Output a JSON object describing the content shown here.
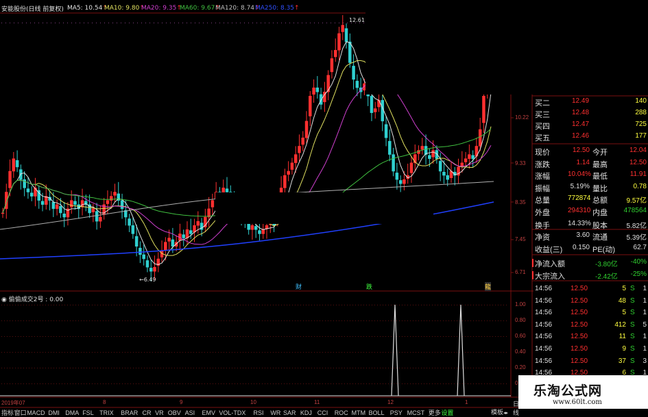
{
  "header": {
    "stock_name": "安能股份(日线 前复权)",
    "ma_items": [
      {
        "text": "MA5: 10.54",
        "color": "#e0e0e0"
      },
      {
        "text": "MA10: 9.80",
        "color": "#e0e060"
      },
      {
        "text": "MA20: 9.35",
        "color": "#d040d0"
      },
      {
        "text": "MA60: 9.67",
        "color": "#40c040"
      },
      {
        "text": "MA120: 8.74",
        "color": "#c0c0c0"
      },
      {
        "text": "MA250: 8.35",
        "color": "#3050ff"
      }
    ]
  },
  "price_axis": [
    "10.22",
    "9.33",
    "8.35",
    "7.45",
    "6.71"
  ],
  "indicator_axis": [
    "1.00",
    "0.80",
    "0.60",
    "0.40",
    "0.20",
    "0.00"
  ],
  "annotations": {
    "high": "12.61",
    "low": "6.49",
    "events": [
      "财",
      "跌",
      "龍"
    ]
  },
  "indicator": {
    "title": "偷偷成交2号 : 0.00"
  },
  "time_axis": [
    "2019年07",
    "8",
    "9",
    "10",
    "11",
    "12",
    "1"
  ],
  "quote": {
    "bids": [
      {
        "label": "买二",
        "price": "12.49",
        "vol": "140"
      },
      {
        "label": "买三",
        "price": "12.48",
        "vol": "288"
      },
      {
        "label": "买四",
        "price": "12.47",
        "vol": "725"
      },
      {
        "label": "买五",
        "price": "12.46",
        "vol": "177"
      }
    ],
    "stats": [
      {
        "l1": "现价",
        "v1": "12.50",
        "l2": "今开",
        "v2": "12.04",
        "c1": "#ff3030",
        "c2": "#ff3030"
      },
      {
        "l1": "涨跌",
        "v1": "1.14",
        "l2": "最高",
        "v2": "12.50",
        "c1": "#ff3030",
        "c2": "#ff3030"
      },
      {
        "l1": "涨幅",
        "v1": "10.04%",
        "l2": "最低",
        "v2": "11.91",
        "c1": "#ff3030",
        "c2": "#ff3030"
      },
      {
        "l1": "振幅",
        "v1": "5.19%",
        "l2": "量比",
        "v2": "0.78",
        "c1": "#e0e0e0",
        "c2": "#ffff40"
      },
      {
        "l1": "总量",
        "v1": "772874",
        "l2": "总额",
        "v2": "9.57亿",
        "c1": "#ffff40",
        "c2": "#ffff40"
      },
      {
        "l1": "外盘",
        "v1": "294310",
        "l2": "内盘",
        "v2": "478564",
        "c1": "#ff3030",
        "c2": "#30d030"
      },
      {
        "l1": "换手",
        "v1": "14.33%",
        "l2": "股本",
        "v2": "5.82亿",
        "c1": "#e0e0e0",
        "c2": "#e0e0e0"
      },
      {
        "l1": "净资",
        "v1": "3.60",
        "l2": "流通",
        "v2": "5.39亿",
        "c1": "#e0e0e0",
        "c2": "#e0e0e0"
      },
      {
        "l1": "收益(三)",
        "v1": "0.150",
        "l2": "PE(动)",
        "v2": "62.7",
        "c1": "#e0e0e0",
        "c2": "#e0e0e0"
      }
    ],
    "flows": [
      {
        "label": "净流入额",
        "value": "-3.80亿",
        "pct": "-40%"
      },
      {
        "label": "大宗流入",
        "value": "-2.42亿",
        "pct": "-25%"
      }
    ],
    "trades": [
      {
        "time": "14:56",
        "price": "12.50",
        "vol": "5",
        "dir": "S",
        "n": "1"
      },
      {
        "time": "14:56",
        "price": "12.50",
        "vol": "48",
        "dir": "S",
        "n": "1"
      },
      {
        "time": "14:56",
        "price": "12.50",
        "vol": "5",
        "dir": "S",
        "n": "1"
      },
      {
        "time": "14:56",
        "price": "12.50",
        "vol": "412",
        "dir": "S",
        "n": "5"
      },
      {
        "time": "14:56",
        "price": "12.50",
        "vol": "11",
        "dir": "S",
        "n": "1"
      },
      {
        "time": "14:56",
        "price": "12.50",
        "vol": "9",
        "dir": "S",
        "n": "1"
      },
      {
        "time": "14:56",
        "price": "12.50",
        "vol": "37",
        "dir": "S",
        "n": "3"
      },
      {
        "time": "14:56",
        "price": "12.50",
        "vol": "6",
        "dir": "S",
        "n": "1"
      }
    ],
    "side_tabs": [
      "日",
      "线"
    ]
  },
  "tabs": [
    "指标",
    "窗口",
    "MACD",
    "DMI",
    "DMA",
    "FSL",
    "TRIX",
    "BRAR",
    "CR",
    "VR",
    "OBV",
    "ASI",
    "EMV",
    "VOL-TDX",
    "RSI",
    "WR",
    "SAR",
    "KDJ",
    "CCI",
    "ROC",
    "MTM",
    "BOLL",
    "PSY",
    "MCST",
    "更多",
    "设置"
  ],
  "tab_right": "模板",
  "watermark": {
    "title": "乐淘公式网",
    "url": "www.60lt.com"
  },
  "colors": {
    "up": "#ff3030",
    "down": "#30d0d0",
    "grid": "#7a1010",
    "bg": "#000000"
  }
}
